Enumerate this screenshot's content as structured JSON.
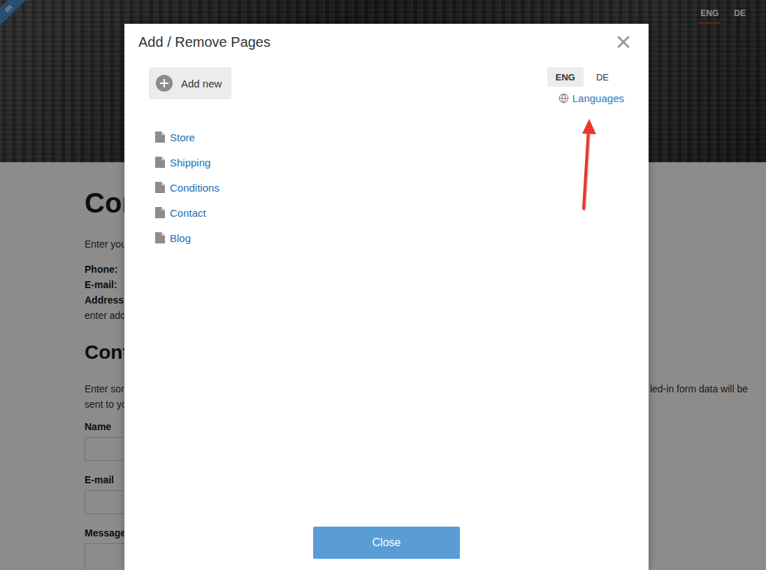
{
  "site": {
    "ribbon": "m",
    "nav": [
      {
        "label": "ENG",
        "selected": true
      },
      {
        "label": "DE",
        "selected": false
      }
    ],
    "heading": "Con",
    "intro": "Enter you",
    "contact_fields": [
      {
        "label": "Phone:"
      },
      {
        "label": "E-mail:"
      },
      {
        "label": "Address"
      }
    ],
    "address_hint": "enter add",
    "form_heading": "Cont",
    "form_intro": [
      "Enter som",
      "sent to yo"
    ],
    "form_intro_right": "led-in form data will be",
    "form_fields": [
      {
        "label": "Name",
        "kind": "input"
      },
      {
        "label": "E-mail",
        "kind": "input"
      },
      {
        "label": "Message",
        "kind": "textarea"
      }
    ]
  },
  "dialog": {
    "title": "Add / Remove Pages",
    "add_button": "Add new",
    "languages": [
      {
        "label": "ENG",
        "selected": true
      },
      {
        "label": "DE",
        "selected": false
      }
    ],
    "languages_link": "Languages",
    "pages": [
      {
        "label": "Store"
      },
      {
        "label": "Shipping"
      },
      {
        "label": "Conditions"
      },
      {
        "label": "Contact"
      },
      {
        "label": "Blog"
      }
    ],
    "close_button": "Close"
  }
}
